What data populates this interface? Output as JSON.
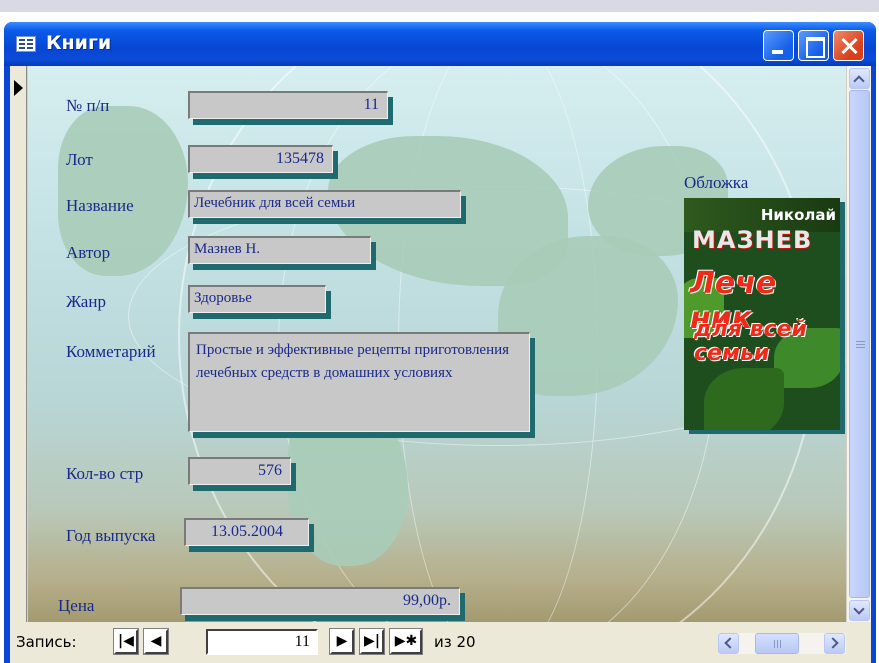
{
  "window": {
    "title": "Книги"
  },
  "form": {
    "fields": [
      {
        "label": "№ п/п",
        "value": "11"
      },
      {
        "label": "Лот",
        "value": "135478"
      },
      {
        "label": "Название",
        "value": "Лечебник для всей семьи"
      },
      {
        "label": "Автор",
        "value": "Мазнев Н."
      },
      {
        "label": "Жанр",
        "value": "Здоровье"
      },
      {
        "label": "Комметарий",
        "value": "Простые и эффективные рецепты приготовления лечебных средств в домашних условиях"
      },
      {
        "label": "Кол-во стр",
        "value": "576"
      },
      {
        "label": "Год выпуска",
        "value": "13.05.2004"
      },
      {
        "label": "Цена",
        "value": "99,00р."
      }
    ],
    "cover": {
      "label": "Обложка",
      "author_first": "Николай",
      "author_last": "МАЗНЕВ",
      "title_line1": "Лече ник",
      "title_line2": "для всей",
      "title_line3": "семьи"
    }
  },
  "navigation": {
    "record_label": "Запись:",
    "first_glyph": "|◀",
    "prev_glyph": "◀",
    "current_record": "11",
    "next_glyph": "▶",
    "last_glyph": "▶|",
    "new_glyph": "▶✱",
    "total": "из 20"
  },
  "colors": {
    "title_bar": "#0a46d6",
    "label_text": "#1a2a8a",
    "field_bg": "#c8c8c8",
    "field_shadow": "#1e6a6e"
  }
}
